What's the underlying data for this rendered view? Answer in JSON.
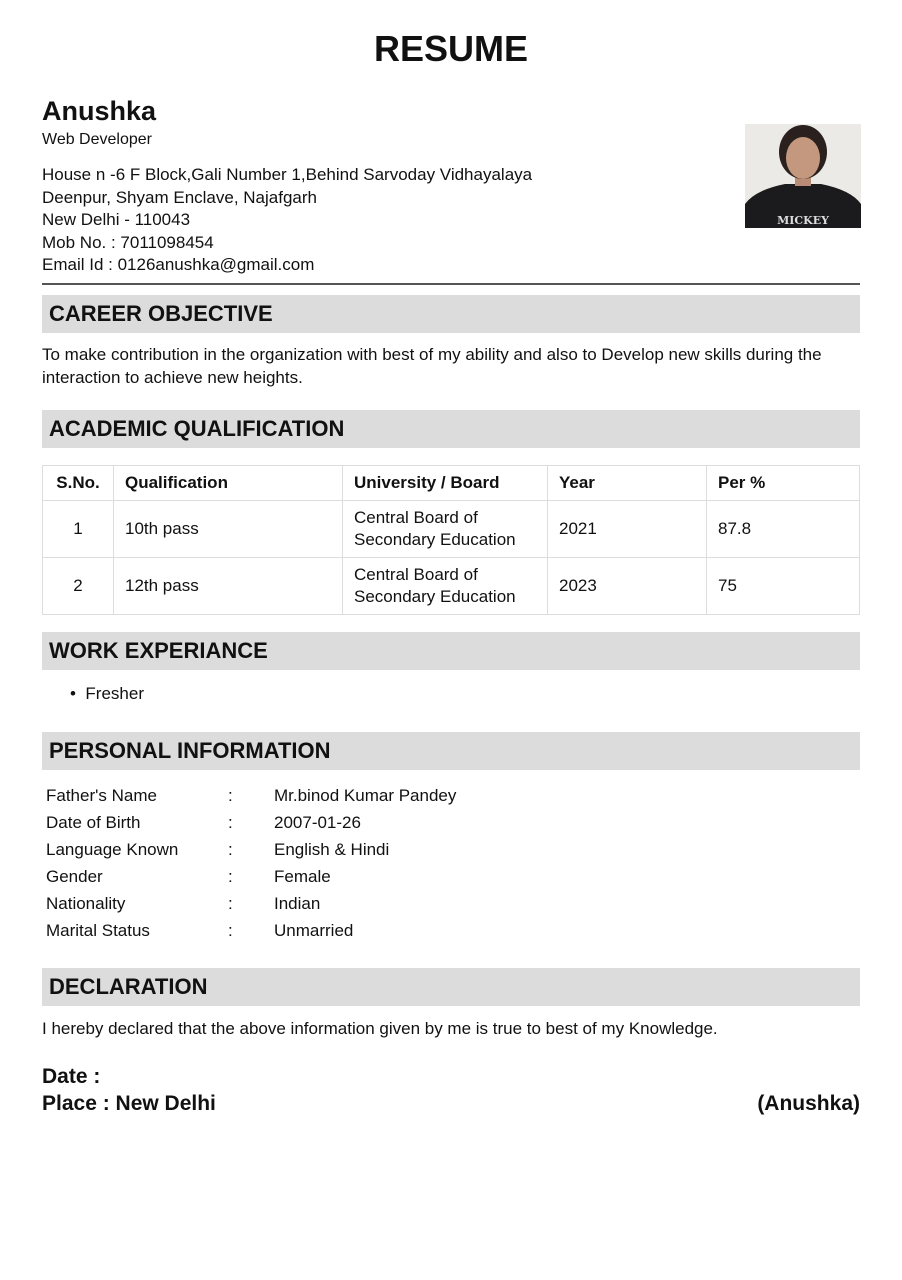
{
  "title": "RESUME",
  "header": {
    "name": "Anushka",
    "role": "Web Developer",
    "address_lines": [
      "House n -6 F Block,Gali Number 1,Behind Sarvoday Vidhayalaya",
      "Deenpur, Shyam Enclave, Najafgarh",
      "New Delhi - 110043"
    ],
    "mobile": "Mob No. : 7011098454",
    "email": "Email Id : 0126anushka@gmail.com",
    "photo_shirt_text": "MICKEY"
  },
  "career": {
    "heading": "CAREER OBJECTIVE",
    "text": "To make contribution in the organization with best of my ability and also to Develop new skills during the interaction to achieve new heights."
  },
  "academic": {
    "heading": "ACADEMIC QUALIFICATION",
    "columns": [
      "S.No.",
      "Qualification",
      "University / Board",
      "Year",
      "Per %"
    ],
    "rows": [
      {
        "sno": "1",
        "qualification": "10th pass",
        "board_line1": "Central Board of",
        "board_line2": "Secondary Education",
        "year": "2021",
        "per": "87.8"
      },
      {
        "sno": "2",
        "qualification": "12th pass",
        "board_line1": "Central Board of",
        "board_line2": "Secondary Education",
        "year": "2023",
        "per": "75"
      }
    ]
  },
  "work": {
    "heading": "WORK EXPERIANCE",
    "items": [
      "Fresher"
    ]
  },
  "personal": {
    "heading": "PERSONAL INFORMATION",
    "separator": ":",
    "rows": [
      {
        "label": "Father's Name",
        "value": "Mr.binod Kumar Pandey"
      },
      {
        "label": "Date of Birth",
        "value": "2007-01-26"
      },
      {
        "label": "Language Known",
        "value": "English & Hindi"
      },
      {
        "label": "Gender",
        "value": "Female"
      },
      {
        "label": "Nationality",
        "value": "Indian"
      },
      {
        "label": "Marital Status",
        "value": "Unmarried"
      }
    ]
  },
  "declaration": {
    "heading": "DECLARATION",
    "text": "I hereby declared that the above information given by me is true to best of my Knowledge."
  },
  "footer": {
    "date": "Date :",
    "place": "Place : New Delhi",
    "signature": "(Anushka)"
  }
}
